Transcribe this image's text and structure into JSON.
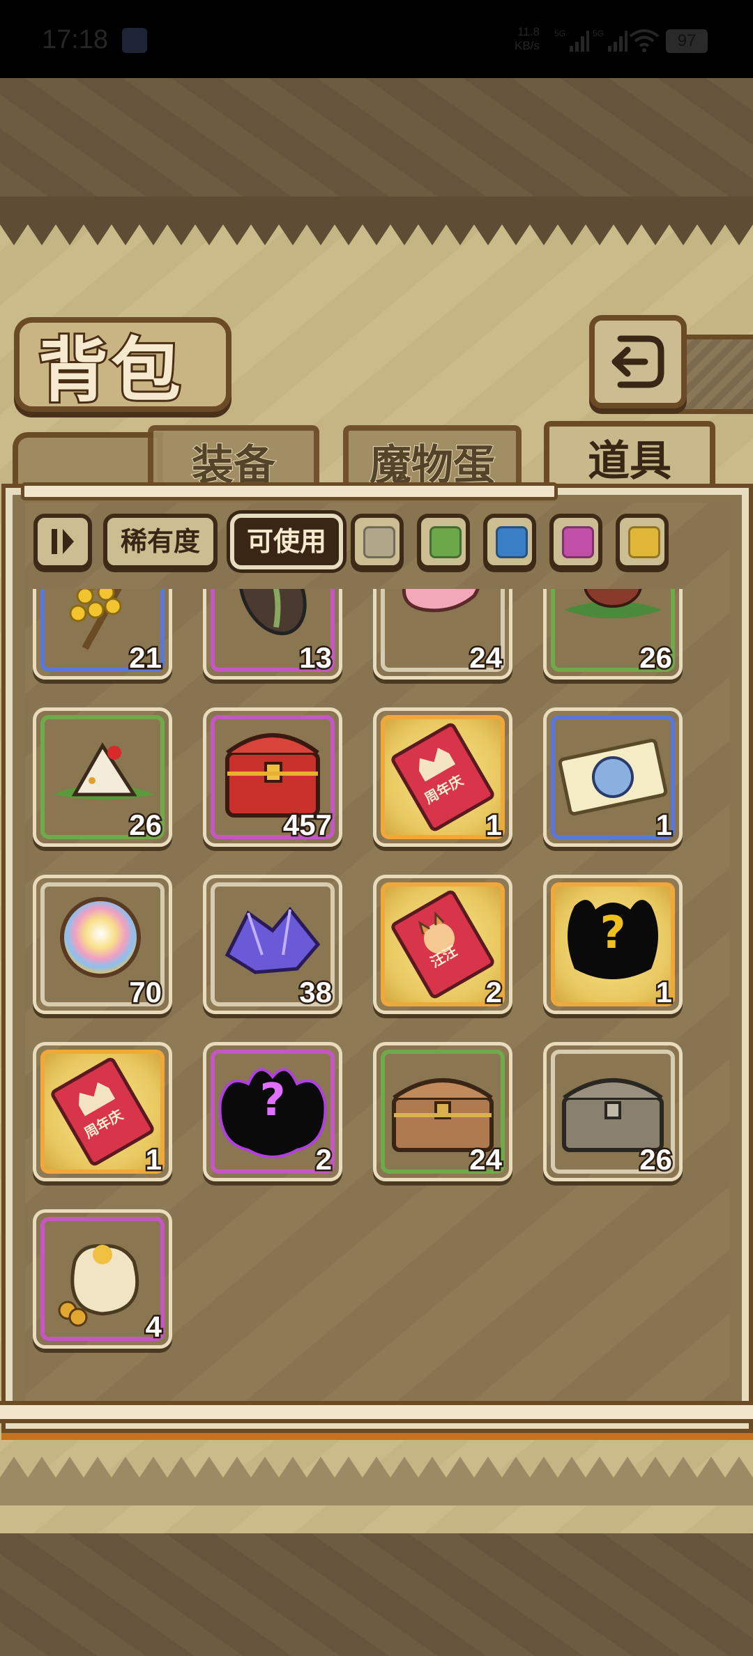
{
  "status_bar": {
    "time": "17:18",
    "net_speed_value": "11.8",
    "net_speed_unit": "KB/s",
    "signal_1": "5G",
    "signal_2": "5G",
    "battery": "97"
  },
  "header": {
    "title": "背包",
    "back_icon": "back-arrow-icon"
  },
  "tabs": [
    {
      "label": "装备",
      "active": false
    },
    {
      "label": "魔物蛋",
      "active": false
    },
    {
      "label": "道具",
      "active": true
    }
  ],
  "filters": {
    "sort_icon": "sort-order-icon",
    "rarity_label": "稀有度",
    "usable_label": "可使用",
    "colors": [
      {
        "name": "grey",
        "hex": "#b1a58a"
      },
      {
        "name": "green",
        "hex": "#6aa84a"
      },
      {
        "name": "blue",
        "hex": "#3a7fc4"
      },
      {
        "name": "purple",
        "hex": "#c04fa8"
      },
      {
        "name": "gold",
        "hex": "#e0b636"
      }
    ]
  },
  "rarity_colors": {
    "grey": "#d8ccb0",
    "green": "#6faa4a",
    "blue": "#5a78d8",
    "purple": "#c457c2",
    "gold": "#f0a83a"
  },
  "items": [
    {
      "icon": "flower-bouquet-icon",
      "rarity": "blue",
      "count": "21"
    },
    {
      "icon": "seed-icon",
      "rarity": "purple",
      "count": "13"
    },
    {
      "icon": "pink-petal-icon",
      "rarity": "grey",
      "count": "24"
    },
    {
      "icon": "meat-dish-icon",
      "rarity": "green",
      "count": "26"
    },
    {
      "icon": "rice-dumpling-icon",
      "rarity": "green",
      "count": "26"
    },
    {
      "icon": "red-treasure-chest-icon",
      "rarity": "purple",
      "count": "457"
    },
    {
      "icon": "anniversary-red-envelope-icon",
      "rarity": "gold",
      "count": "1",
      "text": "周年庆"
    },
    {
      "icon": "monster-ticket-icon",
      "rarity": "blue",
      "count": "1"
    },
    {
      "icon": "rainbow-orb-icon",
      "rarity": "grey",
      "count": "70"
    },
    {
      "icon": "purple-crystal-icon",
      "rarity": "grey",
      "count": "38"
    },
    {
      "icon": "dog-red-envelope-icon",
      "rarity": "gold",
      "count": "2",
      "text": "汪汪"
    },
    {
      "icon": "mystery-monster-icon",
      "rarity": "gold",
      "count": "1",
      "text": "?"
    },
    {
      "icon": "anniversary-red-envelope-icon",
      "rarity": "gold",
      "count": "1",
      "text": "周年庆"
    },
    {
      "icon": "mystery-shadow-icon",
      "rarity": "purple",
      "count": "2",
      "text": "?"
    },
    {
      "icon": "wooden-chest-icon",
      "rarity": "green",
      "count": "24"
    },
    {
      "icon": "grey-chest-icon",
      "rarity": "grey",
      "count": "26"
    },
    {
      "icon": "coin-bag-icon",
      "rarity": "purple",
      "count": "4"
    }
  ]
}
